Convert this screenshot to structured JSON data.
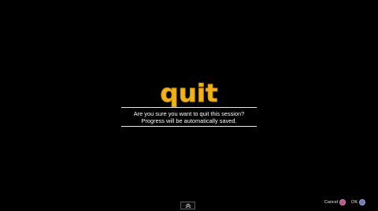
{
  "dialog": {
    "title": "quit",
    "message_line_1": "Are you sure you want to quit this session?",
    "message_line_2": "Progress will be automatically saved."
  },
  "footer": {
    "scroll_icon": "double-chevron-up-icon",
    "prompts": [
      {
        "label": "Cancel",
        "icon": "circle-button-icon",
        "color": "#b15a8e"
      },
      {
        "label": "OK",
        "icon": "cross-button-icon",
        "color": "#6f78b4"
      }
    ]
  },
  "colors": {
    "background": "#000000",
    "title": "#f0b21e",
    "text": "#ffffff"
  }
}
